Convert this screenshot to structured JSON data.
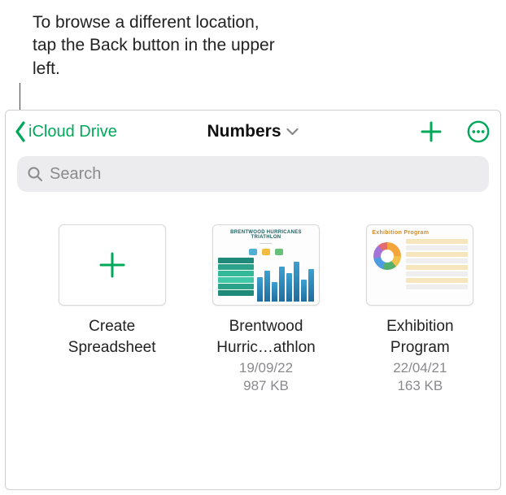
{
  "annotation": "To browse a different location, tap the Back button in the upper left.",
  "nav": {
    "back_label": "iCloud Drive",
    "title": "Numbers"
  },
  "search": {
    "placeholder": "Search",
    "value": ""
  },
  "items": [
    {
      "title_line1": "Create",
      "title_line2": "Spreadsheet",
      "date": "",
      "size": ""
    },
    {
      "title_line1": "Brentwood",
      "title_line2": "Hurric…athlon",
      "date": "19/09/22",
      "size": "987 KB"
    },
    {
      "title_line1": "Exhibition",
      "title_line2": "Program",
      "date": "22/04/21",
      "size": "163 KB"
    }
  ],
  "colors": {
    "accent": "#00a85a"
  }
}
